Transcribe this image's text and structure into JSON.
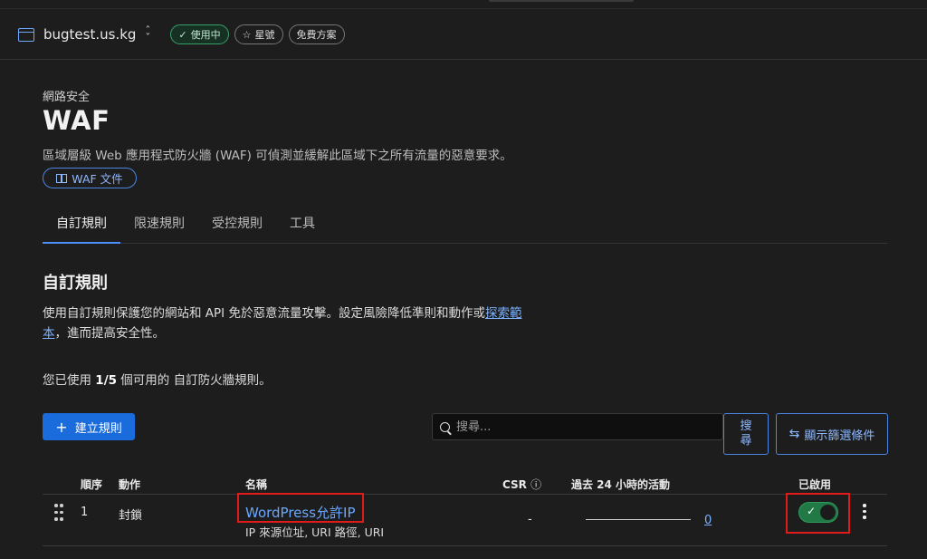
{
  "header": {
    "domain": "bugtest.us.kg",
    "badges": [
      {
        "label": "使用中",
        "icon": "check-icon"
      },
      {
        "label": "星號",
        "icon": "star-icon"
      },
      {
        "label": "免費方案"
      }
    ]
  },
  "page": {
    "breadcrumb": "網路安全",
    "title": "WAF",
    "description": "區域層級 Web 應用程式防火牆 (WAF) 可偵測並緩解此區域下之所有流量的惡意要求。",
    "doc_button": "WAF 文件"
  },
  "tabs": [
    {
      "label": "自訂規則",
      "active": true
    },
    {
      "label": "限速規則",
      "active": false
    },
    {
      "label": "受控規則",
      "active": false
    },
    {
      "label": "工具",
      "active": false
    }
  ],
  "section": {
    "title": "自訂規則",
    "desc_text": "使用自訂規則保護您的網站和 API 免於惡意流量攻擊。設定風險降低準則和動作或",
    "desc_link_1": "探索範",
    "desc_link_2": "本",
    "desc_tail": "，進而提高安全性。",
    "usage_pre": "您已使用 ",
    "usage_count": "1/5",
    "usage_post": " 個可用的 自訂防火牆規則。"
  },
  "toolbar": {
    "create_label": "建立規則",
    "search_placeholder": "搜尋...",
    "search_button_1": "搜",
    "search_button_2": "尋",
    "filter_label": "顯示篩選條件"
  },
  "table": {
    "headers": {
      "order": "順序",
      "action": "動作",
      "name": "名稱",
      "csr": "CSR",
      "activity": "過去 24 小時的活動",
      "enabled": "已啟用"
    },
    "rows": [
      {
        "order": "1",
        "action": "封鎖",
        "name": "WordPress允許IP",
        "subtitle": "IP 來源位址, URI 路徑, URI",
        "csr": "-",
        "activity_count": "0",
        "enabled": true
      }
    ]
  },
  "colors": {
    "accent": "#1a6bdc",
    "link": "#6aa8ff",
    "toggle_on": "#217a45",
    "highlight": "#e01b1b"
  }
}
